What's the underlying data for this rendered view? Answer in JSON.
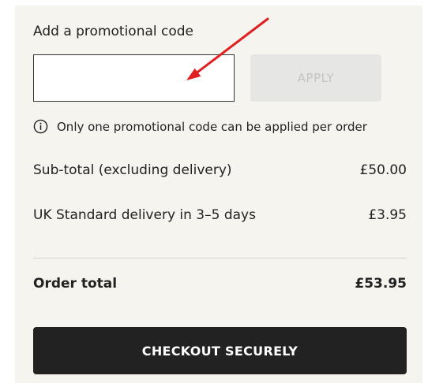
{
  "promo": {
    "heading": "Add a promotional code",
    "input_value": "",
    "input_placeholder": "",
    "apply_label": "APPLY",
    "info_text": "Only one promotional code can be applied per order"
  },
  "summary": {
    "subtotal_label": "Sub-total (excluding delivery)",
    "subtotal_value": "£50.00",
    "delivery_label": "UK Standard delivery in 3–5 days",
    "delivery_value": "£3.95",
    "total_label": "Order total",
    "total_value": "£53.95"
  },
  "checkout": {
    "label": "CHECKOUT SECURELY"
  },
  "colors": {
    "panel_background": "#f6f4ef",
    "apply_disabled_bg": "#e6e6e4",
    "checkout_bg": "#222222",
    "annotation_arrow": "#e02020"
  },
  "icons": {
    "info": "info-circle-icon",
    "annotation": "red-arrow-annotation"
  }
}
